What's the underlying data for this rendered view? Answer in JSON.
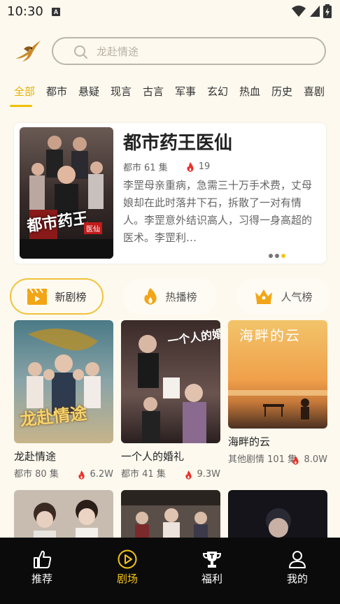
{
  "status": {
    "time": "10:30",
    "notif": "A"
  },
  "search": {
    "placeholder": "龙赴情途"
  },
  "categories": [
    "全部",
    "都市",
    "悬疑",
    "现言",
    "古言",
    "军事",
    "玄幻",
    "热血",
    "历史",
    "喜剧"
  ],
  "featured": {
    "title": "都市药王医仙",
    "genre": "都市",
    "episodes": "61 集",
    "heat": "19",
    "description": "李罡母亲重病，急需三十万手术费，丈母娘却在此时落井下石，拆散了一对有情人。李罡意外结识高人，习得一身高超的医术。李罡利…",
    "poster_text": "都市药王",
    "poster_badge": "医仙",
    "pages": 3,
    "active_page": 2
  },
  "rank_tabs": [
    {
      "label": "新剧榜",
      "icon": "clapperboard-icon"
    },
    {
      "label": "热播榜",
      "icon": "flame-icon"
    },
    {
      "label": "人气榜",
      "icon": "crown-icon"
    }
  ],
  "dramas": [
    {
      "title": "龙赴情途",
      "genre": "都市",
      "episodes": "80 集",
      "views": "6.2W",
      "poster_text": "龙赴情途"
    },
    {
      "title": "一个人的婚礼",
      "genre": "都市",
      "episodes": "41 集",
      "views": "9.3W",
      "poster_text": "一个人的婚礼"
    },
    {
      "title": "海畔的云",
      "genre": "其他剧情",
      "episodes": "101 集",
      "views": "8.0W",
      "poster_text": "海畔的云"
    }
  ],
  "nav": [
    {
      "label": "推荐",
      "icon": "thumbs-up-icon"
    },
    {
      "label": "剧场",
      "icon": "play-circle-icon"
    },
    {
      "label": "福利",
      "icon": "trophy-icon"
    },
    {
      "label": "我的",
      "icon": "user-icon"
    }
  ],
  "colors": {
    "accent": "#f5c518",
    "background": "#fdf9ef",
    "nav_bg": "#0b0b0b",
    "fire": "#e8322a"
  }
}
